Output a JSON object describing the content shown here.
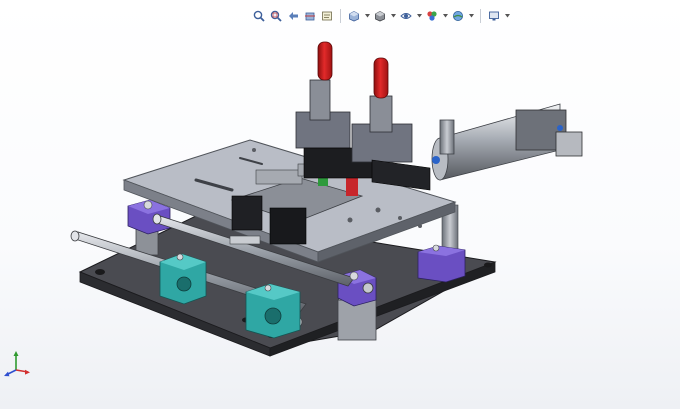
{
  "heads_up_toolbar": {
    "buttons": [
      {
        "name": "zoom-to-fit-icon"
      },
      {
        "name": "zoom-to-area-icon"
      },
      {
        "name": "previous-view-icon"
      },
      {
        "name": "section-view-icon"
      },
      {
        "name": "dynamic-annotation-icon"
      },
      {
        "name": "view-orientation-icon",
        "dropdown": true
      },
      {
        "name": "display-style-icon",
        "dropdown": true
      },
      {
        "name": "hide-show-items-icon",
        "dropdown": true
      },
      {
        "name": "edit-appearance-icon",
        "dropdown": true
      },
      {
        "name": "apply-scene-icon",
        "dropdown": true
      },
      {
        "name": "view-settings-icon",
        "dropdown": true
      }
    ]
  },
  "model": {
    "description_icon": "cad-fixture-assembly",
    "colors": {
      "base_plate": "#3c3d42",
      "top_plate": "#b9bdc6",
      "clamp_handles": "#d42020",
      "purple_blocks": "#6a4fc2",
      "teal_blocks": "#2fa7a4",
      "steel": "#9aa0a8"
    }
  },
  "triad": {
    "axes": [
      "x",
      "y",
      "z"
    ],
    "colors": {
      "x": "#d23030",
      "y": "#2f9a2f",
      "z": "#2f4fd0"
    }
  }
}
